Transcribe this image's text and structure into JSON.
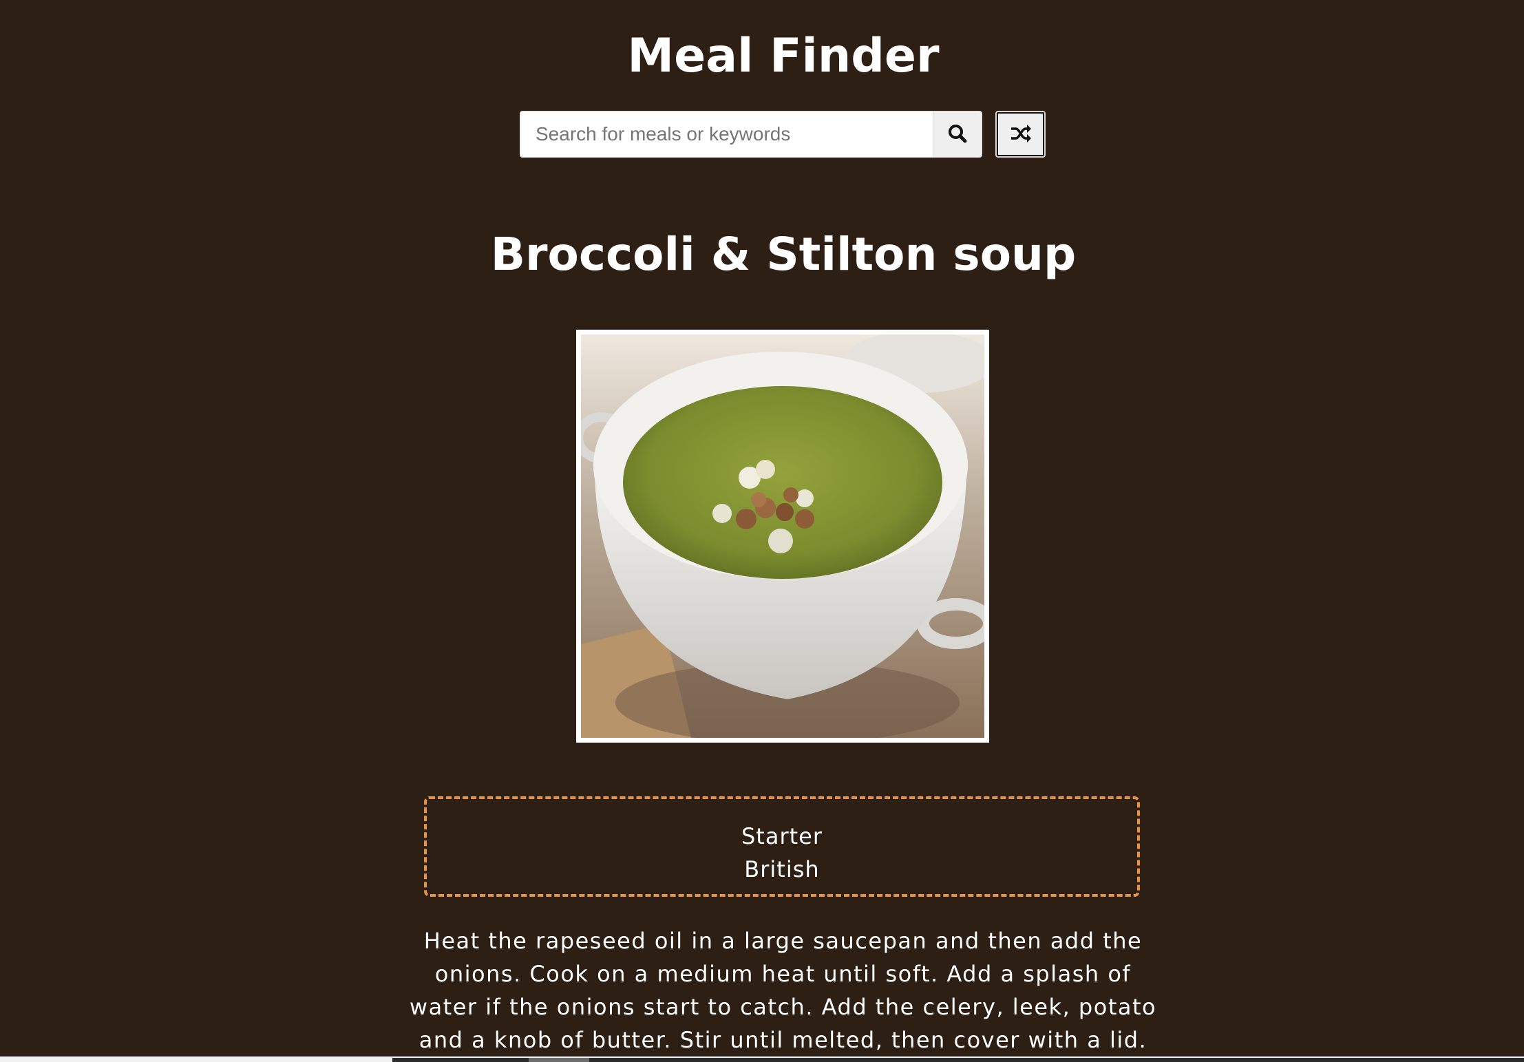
{
  "header": {
    "title": "Meal Finder"
  },
  "search": {
    "placeholder": "Search for meals or keywords",
    "value": "",
    "search_icon": "search-icon",
    "random_icon": "shuffle-icon"
  },
  "meal": {
    "title": "Broccoli & Stilton soup",
    "image_alt": "Broccoli & Stilton soup",
    "category": "Starter",
    "area": "British",
    "instructions": "Heat the rapeseed oil in a large saucepan and then add the onions. Cook on a medium heat until soft. Add a splash of water if the onions start to catch. Add the celery, leek, potato and a knob of butter. Stir until melted, then cover with a lid. Allow to"
  },
  "colors": {
    "background": "#2d1f14",
    "text": "#ffffff",
    "category_border": "#e59447",
    "soup": "#7e8f2e"
  }
}
